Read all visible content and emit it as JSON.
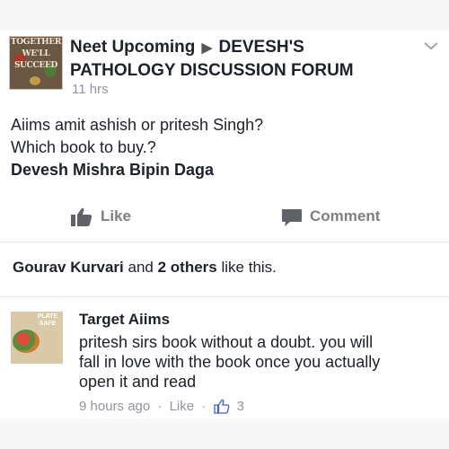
{
  "post": {
    "group_avatar_text": [
      "TOGETHER",
      "WE'LL",
      "SUCCEED"
    ],
    "author": "Neet Upcoming",
    "arrow": "▶",
    "group_line1": "DEVESH'S",
    "group_line2": "PATHOLOGY DISCUSSION FORUM",
    "time": "11 hrs",
    "body_line1": "Aiims amit ashish or pritesh Singh?",
    "body_line2": "Which book to buy.?",
    "tagged": "Devesh Mishra Bipin Daga"
  },
  "actions": {
    "like_label": "Like",
    "comment_label": "Comment"
  },
  "likes": {
    "name": "Gourav Kurvari",
    "and_text": "and",
    "others": "2 others",
    "suffix": "like this."
  },
  "comment": {
    "avatar_text": [
      "PLATE",
      "SAFE"
    ],
    "name": "Target Aiims",
    "line1": "pritesh sirs book without a doubt. you will",
    "line2": "fall in love with the book once you actually",
    "line3": "open it and read",
    "time": "9 hours ago",
    "separator": "·",
    "like_label": "Like",
    "like_count": "3"
  },
  "colors": {
    "text": "#1d2129",
    "meta": "#90949c",
    "action": "#7f7f7f",
    "icon": "#5f6368"
  },
  "icons": {
    "like": "thumbs-up-icon",
    "comment": "speech-bubble-icon",
    "menu": "chevron-down-icon",
    "comment_like": "thumbs-up-outline-icon"
  }
}
